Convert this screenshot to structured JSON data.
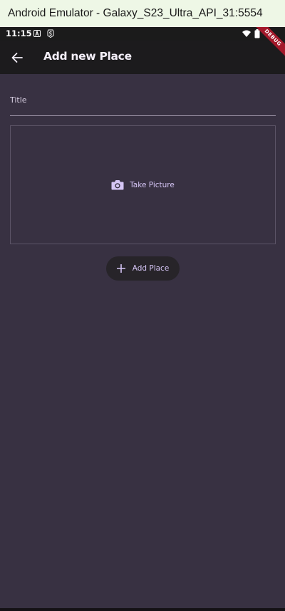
{
  "emulator": {
    "window_title": "Android Emulator - Galaxy_S23_Ultra_API_31:5554"
  },
  "status_bar": {
    "time": "11:15",
    "icons": [
      "a-notification-icon",
      "s-notification-icon",
      "wifi-icon",
      "battery-icon"
    ]
  },
  "debug_banner": {
    "label": "DEBUG"
  },
  "app_bar": {
    "title": "Add new Place",
    "back_icon": "arrow-back-icon"
  },
  "form": {
    "title_label": "Title",
    "take_picture_label": "Take Picture",
    "take_picture_icon": "camera-icon",
    "add_place_label": "Add Place",
    "add_place_icon": "plus-icon"
  },
  "colors": {
    "background": "#383142",
    "app_bar": "#1c1b1d",
    "accent": "#d5c5f5",
    "debug": "#a3182a"
  }
}
